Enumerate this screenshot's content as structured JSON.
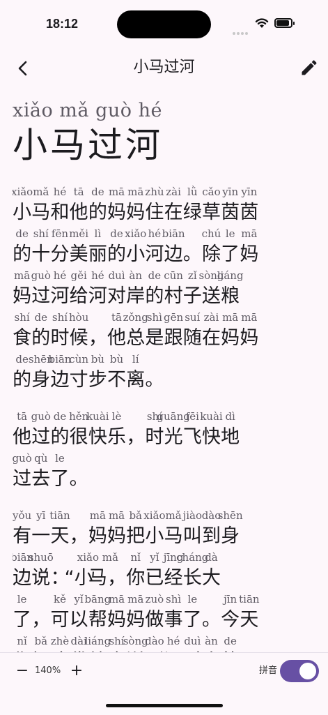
{
  "status_bar": {
    "time": "18:12"
  },
  "app_bar": {
    "title": "小马过河",
    "back_icon": "back-arrow-icon",
    "edit_icon": "pencil-icon"
  },
  "header": {
    "pinyin": "xiǎo mǎ guò hé",
    "hanzi": "小马过河"
  },
  "paragraphs": [
    [
      [
        [
          "小",
          "xiǎo"
        ],
        [
          "马",
          "mǎ"
        ],
        [
          "和",
          "hé"
        ],
        [
          "他",
          "tā"
        ],
        [
          "的",
          "de"
        ],
        [
          "妈",
          "mā"
        ],
        [
          "妈",
          "mā"
        ],
        [
          "住",
          "zhù"
        ],
        [
          "在",
          "zài"
        ],
        [
          "绿",
          "lǜ"
        ],
        [
          "草",
          "cǎo"
        ],
        [
          "茵",
          "yīn"
        ],
        [
          "茵",
          "yīn"
        ]
      ],
      [
        [
          "的",
          "de"
        ],
        [
          "十",
          "shí"
        ],
        [
          "分",
          "fēn"
        ],
        [
          "美",
          "měi"
        ],
        [
          "丽",
          "lì"
        ],
        [
          "的",
          "de"
        ],
        [
          "小",
          "xiǎo"
        ],
        [
          "河",
          "hé"
        ],
        [
          "边",
          "biān"
        ],
        [
          "。",
          ""
        ],
        [
          "除",
          "chú"
        ],
        [
          "了",
          "le"
        ],
        [
          "妈",
          "mā"
        ]
      ],
      [
        [
          "妈",
          "mā"
        ],
        [
          "过",
          "guò"
        ],
        [
          "河",
          "hé"
        ],
        [
          "给",
          "gěi"
        ],
        [
          "河",
          "hé"
        ],
        [
          "对",
          "duì"
        ],
        [
          "岸",
          "àn"
        ],
        [
          "的",
          "de"
        ],
        [
          "村",
          "cūn"
        ],
        [
          "子",
          "zǐ"
        ],
        [
          "送",
          "sòng"
        ],
        [
          "粮",
          "liáng"
        ]
      ],
      [
        [
          "食",
          "shí"
        ],
        [
          "的",
          "de"
        ],
        [
          "时",
          "shí"
        ],
        [
          "候",
          "hòu"
        ],
        [
          "，",
          ""
        ],
        [
          "他",
          "tā"
        ],
        [
          "总",
          "zǒng"
        ],
        [
          "是",
          "shì"
        ],
        [
          "跟",
          "gēn"
        ],
        [
          "随",
          "suí"
        ],
        [
          "在",
          "zài"
        ],
        [
          "妈",
          "mā"
        ],
        [
          "妈",
          "mā"
        ]
      ],
      [
        [
          "的",
          "de"
        ],
        [
          "身",
          "shēn"
        ],
        [
          "边",
          "biān"
        ],
        [
          "寸",
          "cùn"
        ],
        [
          "步",
          "bù"
        ],
        [
          "不",
          "bù"
        ],
        [
          "离",
          "lí"
        ],
        [
          "。",
          ""
        ]
      ]
    ],
    [
      [
        [
          "他",
          "tā"
        ],
        [
          "过",
          "guò"
        ],
        [
          "的",
          "de"
        ],
        [
          "很",
          "hěn"
        ],
        [
          "快",
          "kuài"
        ],
        [
          "乐",
          "lè"
        ],
        [
          "，",
          ""
        ],
        [
          "时",
          "shí"
        ],
        [
          "光",
          "guāng"
        ],
        [
          "飞",
          "fēi"
        ],
        [
          "快",
          "kuài"
        ],
        [
          "地",
          "dì"
        ]
      ],
      [
        [
          "过",
          "guò"
        ],
        [
          "去",
          "qù"
        ],
        [
          "了",
          "le"
        ],
        [
          "。",
          ""
        ]
      ]
    ],
    [
      [
        [
          "有",
          "yǒu"
        ],
        [
          "一",
          "yī"
        ],
        [
          "天",
          "tiān"
        ],
        [
          "，",
          ""
        ],
        [
          "妈",
          "mā"
        ],
        [
          "妈",
          "mā"
        ],
        [
          "把",
          "bǎ"
        ],
        [
          "小",
          "xiǎo"
        ],
        [
          "马",
          "mǎ"
        ],
        [
          "叫",
          "jiào"
        ],
        [
          "到",
          "dào"
        ],
        [
          "身",
          "shēn"
        ]
      ],
      [
        [
          "边",
          "biān"
        ],
        [
          "说",
          "shuō"
        ],
        [
          "：",
          ""
        ],
        [
          "“小",
          ""
        ],
        [
          "马",
          "xiǎo mǎ"
        ],
        [
          "，",
          ""
        ],
        [
          "你",
          "nǐ"
        ],
        [
          "已",
          "yǐ"
        ],
        [
          "经",
          "jīng"
        ],
        [
          "长",
          "cháng"
        ],
        [
          "大",
          "dà"
        ]
      ],
      [
        [
          "了",
          "le"
        ],
        [
          "，",
          ""
        ],
        [
          "可",
          "kě"
        ],
        [
          "以",
          "yǐ"
        ],
        [
          "帮",
          "bāng"
        ],
        [
          "妈",
          "mā"
        ],
        [
          "妈",
          "mā"
        ],
        [
          "做",
          "zuò"
        ],
        [
          "事",
          "shì"
        ],
        [
          "了",
          "le"
        ],
        [
          "。",
          ""
        ],
        [
          "今",
          "jīn"
        ],
        [
          "天",
          "tiān"
        ]
      ],
      [
        [
          "你",
          "nǐ"
        ],
        [
          "把",
          "bǎ"
        ],
        [
          "这",
          "zhè"
        ],
        [
          "袋",
          "dài"
        ],
        [
          "粮",
          "liáng"
        ],
        [
          "食",
          "shí"
        ],
        [
          "送",
          "sòng"
        ],
        [
          "到",
          "dào"
        ],
        [
          "河",
          "hé"
        ],
        [
          "对",
          "duì"
        ],
        [
          "岸",
          "àn"
        ],
        [
          "的",
          "de"
        ]
      ]
    ]
  ],
  "bottom_bar": {
    "zoom_minus": "−",
    "zoom_value": "140%",
    "zoom_plus": "+",
    "pinyin_label": "拼音",
    "pinyin_enabled": true
  }
}
